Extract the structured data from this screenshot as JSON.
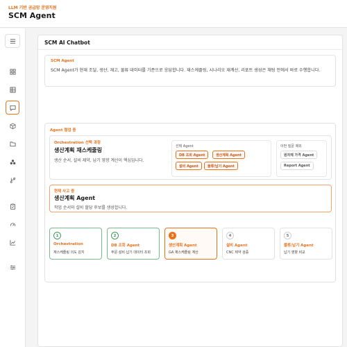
{
  "header": {
    "subtitle": "LLM 기반 공급망 운영지원",
    "title": "SCM Agent"
  },
  "sidebar": {
    "menu_icon": "menu-icon",
    "items": [
      {
        "icon": "dashboard-icon",
        "active": false
      },
      {
        "icon": "table-icon",
        "active": false
      },
      {
        "icon": "chat-icon",
        "active": true
      },
      {
        "icon": "box-icon",
        "active": false
      },
      {
        "icon": "folder-icon",
        "active": false
      },
      {
        "icon": "cluster-icon",
        "active": false
      },
      {
        "icon": "branch-icon",
        "active": false
      },
      {
        "icon": "clipboard-icon",
        "active": false
      },
      {
        "icon": "gauge-icon",
        "active": false
      },
      {
        "icon": "line-chart-icon",
        "active": false
      },
      {
        "icon": "sliders-icon",
        "active": false
      }
    ]
  },
  "main": {
    "title": "SCM AI Chatbot",
    "intro": {
      "label": "SCM Agent",
      "text": "SCM Agent가 현재 조달, 생산, 재고, 물류 데이터를 기준으로 응답합니다. 재스케줄링, 시나리오 재계산, 리포트 생성은 채팅 안에서 바로 수행합니다."
    },
    "agents": {
      "label": "Agent 협업 중",
      "orchestration": {
        "label": "Orchestration 선택 과정",
        "title": "생산계획 재스케줄링",
        "desc": "생산 순서, 설비 제약, 납기 영향 계산이 핵심입니다."
      },
      "selected": {
        "label": "선택 Agent",
        "pills": [
          "DB 조회 Agent",
          "생산계획 Agent",
          "설비 Agent",
          "물류/납기 Agent"
        ]
      },
      "excluded": {
        "label": "이번 질문 제외",
        "pills": [
          "원자재 가격 Agent",
          "Report Agent"
        ]
      },
      "current": {
        "label": "현재 사고 중",
        "title": "생산계획 Agent",
        "desc": "작업 순서와 설비 할당 후보를 생성합니다."
      },
      "steps": [
        {
          "num": "1",
          "name": "Orchestration",
          "desc": "재스케줄링 의도 감지",
          "state": "done"
        },
        {
          "num": "2",
          "name": "DB 조회 Agent",
          "desc": "주문·설비·납기 데이터 조회",
          "state": "done"
        },
        {
          "num": "3",
          "name": "생산계획 Agent",
          "desc": "GA 재스케줄링 계산",
          "state": "active"
        },
        {
          "num": "4",
          "name": "설비 Agent",
          "desc": "CNC 제약 검증",
          "state": "pending"
        },
        {
          "num": "5",
          "name": "물류/납기 Agent",
          "desc": "납기 영향 비교",
          "state": "pending"
        }
      ]
    }
  }
}
